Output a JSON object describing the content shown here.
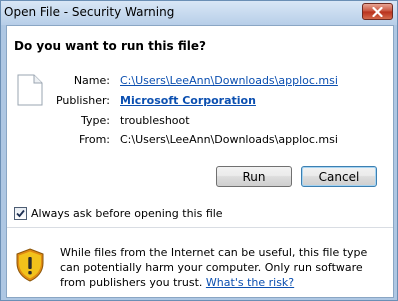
{
  "window": {
    "title": "Open File - Security Warning"
  },
  "dialog": {
    "question": "Do you want to run this file?",
    "fields": {
      "name_label": "Name:",
      "name_value": "C:\\Users\\LeeAnn\\Downloads\\apploc.msi",
      "publisher_label": "Publisher:",
      "publisher_value": "Microsoft Corporation",
      "type_label": "Type:",
      "type_value": "troubleshoot",
      "from_label": "From:",
      "from_value": "C:\\Users\\LeeAnn\\Downloads\\apploc.msi"
    },
    "buttons": {
      "run": "Run",
      "cancel": "Cancel"
    },
    "checkbox": {
      "label": "Always ask before opening this file",
      "checked": true
    },
    "warning": {
      "text": "While files from the Internet can be useful, this file type can potentially harm your computer. Only run software from publishers you trust.",
      "link": "What's the risk?"
    }
  },
  "icons": {
    "close": "close-icon",
    "file": "file-icon",
    "checkmark": "checkmark-icon",
    "shield": "shield-warning-icon"
  },
  "colors": {
    "link": "#0b4fb0",
    "close_button": "#c7503a",
    "shield_yellow": "#f2c21b",
    "shield_orange": "#e08a14"
  }
}
